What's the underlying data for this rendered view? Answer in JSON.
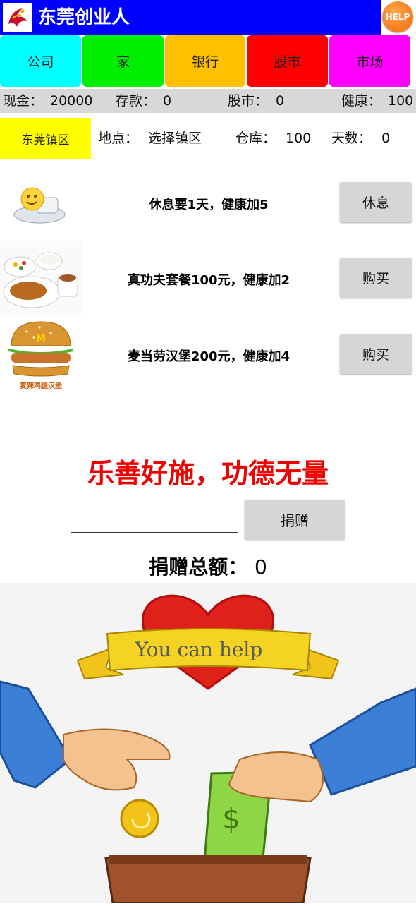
{
  "header": {
    "title": "东莞创业人",
    "help_label": "HELP"
  },
  "tabs": [
    {
      "label": "公司",
      "color": "#00ffff"
    },
    {
      "label": "家",
      "color": "#00ee00"
    },
    {
      "label": "银行",
      "color": "#ffc000"
    },
    {
      "label": "股市",
      "color": "#ff0000"
    },
    {
      "label": "市场",
      "color": "#ff00ff"
    }
  ],
  "status": {
    "cash_label": "现金：",
    "cash_value": "20000",
    "deposit_label": "存款：",
    "deposit_value": "0",
    "stock_label": "股市：",
    "stock_value": "0",
    "health_label": "健康：",
    "health_value": "100"
  },
  "info": {
    "district_button": "东莞镇区",
    "location_label": "地点：",
    "location_value": "选择镇区",
    "warehouse_label": "仓库：",
    "warehouse_value": "100",
    "days_label": "天数：",
    "days_value": "0"
  },
  "actions": [
    {
      "text": "休息要1天，健康加5",
      "button": "休息",
      "icon": "resting-smiley-icon"
    },
    {
      "text": "真功夫套餐100元，健康加2",
      "button": "购买",
      "icon": "meal-set-image"
    },
    {
      "text": "麦当劳汉堡200元，健康加4",
      "button": "购买",
      "icon": "burger-image",
      "image_caption": "麦辣鸡腿汉堡"
    }
  ],
  "donation": {
    "heading": "乐善好施，功德无量",
    "input_value": "",
    "button": "捐赠",
    "total_label": "捐赠总额：",
    "total_value": "0"
  },
  "illustration": {
    "banner_text": "You can help",
    "icon": "donation-illustration"
  }
}
